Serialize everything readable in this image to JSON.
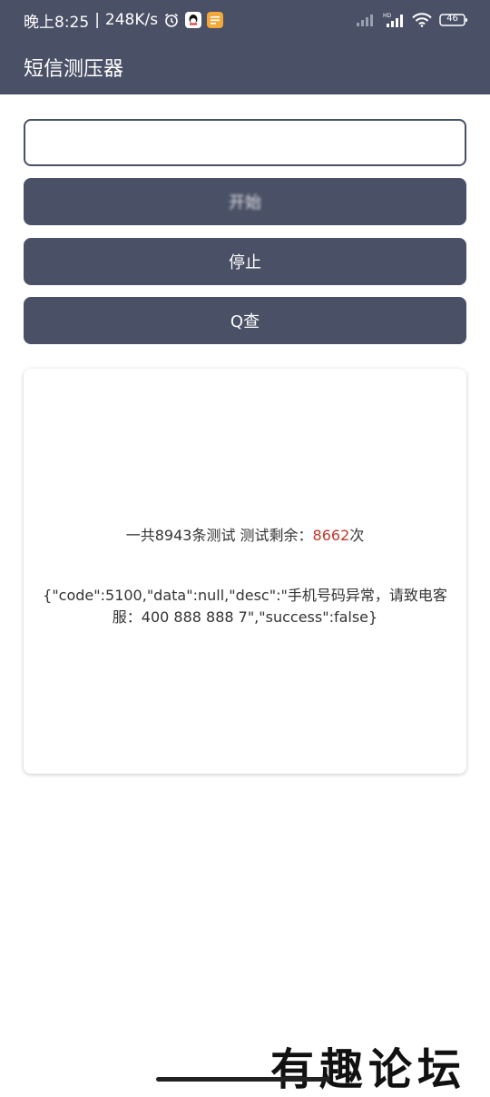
{
  "status_bar": {
    "time": "晚上8:25",
    "net_speed": "248K/s",
    "battery": "46",
    "icons": [
      "alarm-icon",
      "qq-icon",
      "notes-icon",
      "signal-icon",
      "hd-signal-icon",
      "wifi-icon",
      "battery-icon"
    ]
  },
  "app_bar": {
    "title": "短信测压器"
  },
  "phone_input": {
    "value": "",
    "placeholder": ""
  },
  "buttons": {
    "start": "开始",
    "stop": "停止",
    "query": "Q查"
  },
  "result": {
    "count_prefix": "一共8943条测试 测试剩余：",
    "remaining": "8662",
    "count_suffix": "次",
    "response": "{\"code\":5100,\"data\":null,\"desc\":\"手机号码异常，请致电客服：400 888 888 7\",\"success\":false}"
  },
  "watermark": "有趣论坛",
  "colors": {
    "primary": "#4a5066",
    "accent_red": "#c0392b"
  }
}
